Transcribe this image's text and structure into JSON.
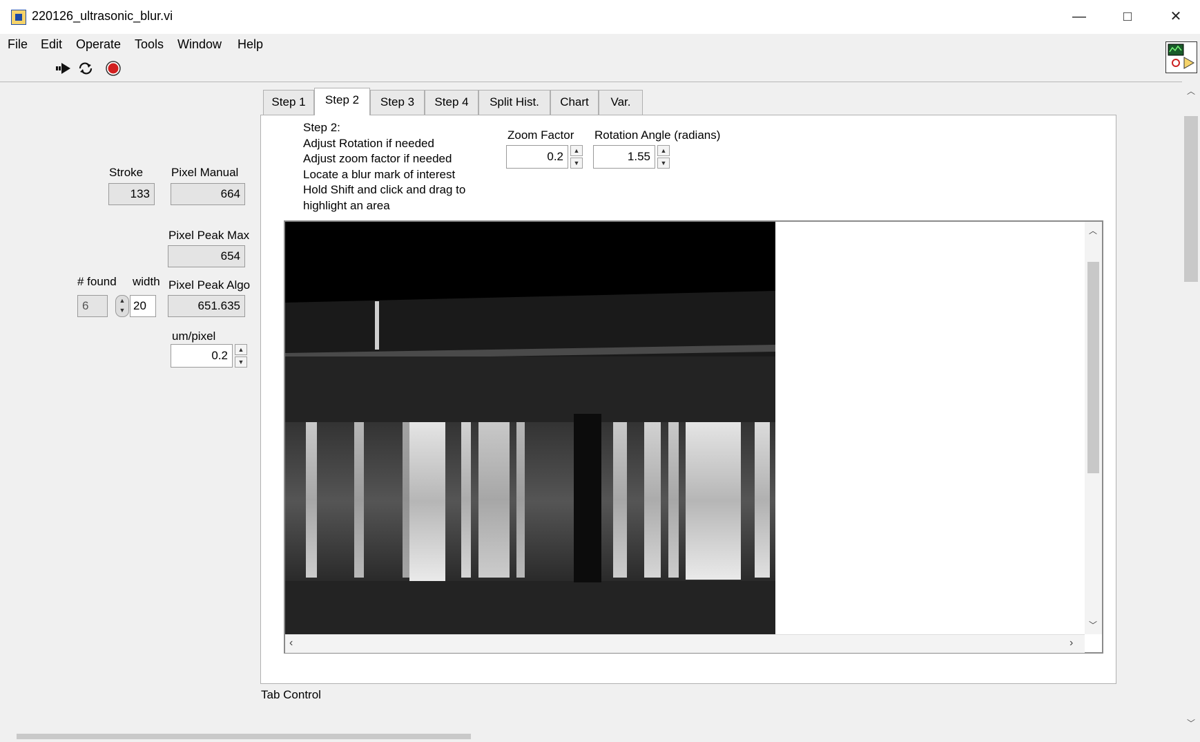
{
  "window": {
    "title": "220126_ultrasonic_blur.vi"
  },
  "menu": [
    "File",
    "Edit",
    "Operate",
    "Tools",
    "Window",
    "Help"
  ],
  "toolbar": {
    "icons": [
      "run-arrow-icon",
      "run-continuously-icon",
      "abort-stop-icon"
    ]
  },
  "indicators": {
    "stroke": {
      "label": "Stroke",
      "value": "133"
    },
    "pixel_manual": {
      "label": "Pixel Manual",
      "value": "664"
    },
    "pixel_peak_max": {
      "label": "Pixel Peak Max",
      "value": "654"
    },
    "found": {
      "label": "# found",
      "value": "6"
    },
    "width": {
      "label": "width",
      "value": "20"
    },
    "pixel_peak_algo": {
      "label": "Pixel Peak Algo",
      "value": "651.635"
    },
    "um_per_pixel": {
      "label": "um/pixel",
      "value": "0.2"
    }
  },
  "tabs": [
    "Step 1",
    "Step 2",
    "Step 3",
    "Step 4",
    "Split Hist.",
    "Chart",
    "Var."
  ],
  "active_tab": "Step 2",
  "instructions": [
    "Step 2:",
    "Adjust Rotation if needed",
    "Adjust zoom factor if needed",
    "Locate a blur mark of interest",
    "Hold Shift and click and drag to",
    "highlight an area"
  ],
  "zoom_factor": {
    "label": "Zoom Factor",
    "value": "0.2"
  },
  "rotation_angle": {
    "label": "Rotation Angle (radians)",
    "value": "1.55"
  },
  "tab_control_label": "Tab Control",
  "colors": {
    "title_bg": "#ffffff",
    "panel_bg": "#f0f0f0",
    "abort_red": "#d21f1f"
  }
}
